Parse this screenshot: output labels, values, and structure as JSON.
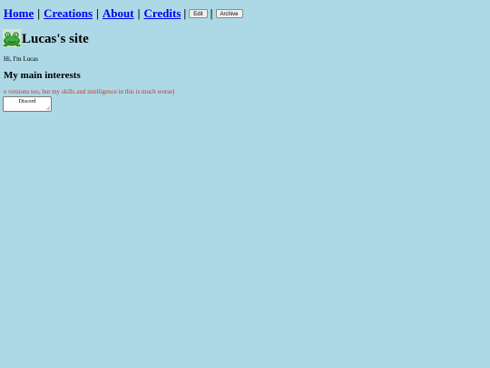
{
  "nav": {
    "links": [
      {
        "label": "Home"
      },
      {
        "label": "Creations"
      },
      {
        "label": "About"
      },
      {
        "label": "Credits"
      }
    ],
    "separator": "|",
    "edit_label": "Edit",
    "archive_label": "Archive"
  },
  "header": {
    "title": "Lucas's site",
    "logo_icon": "frog-icon"
  },
  "greeting": "Hi, I'm Lucas",
  "interests": {
    "heading": "My main interests",
    "scrolling_text": "e versions too, but my skills and intelligence in this is much worse)"
  },
  "discord": {
    "label": "Discord"
  },
  "colors": {
    "background": "#add8e6",
    "link": "#0000ee",
    "scrolling_text": "#c0392b"
  }
}
